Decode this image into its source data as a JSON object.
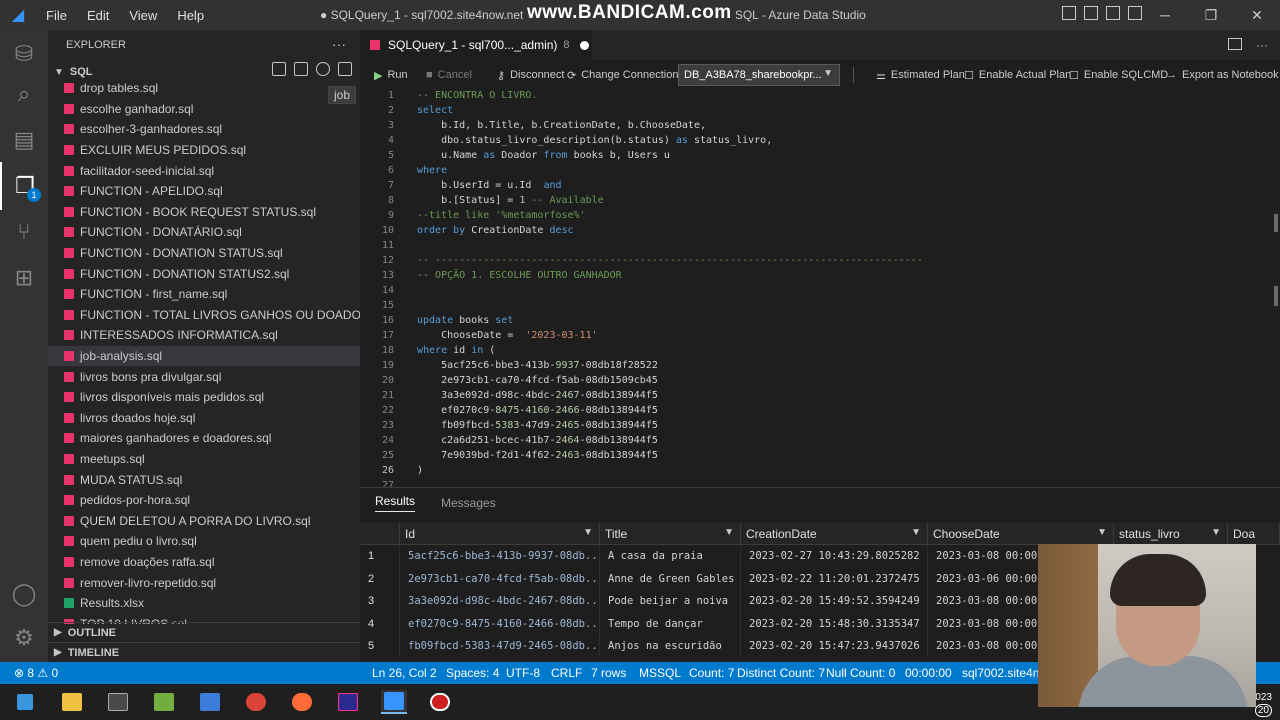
{
  "window": {
    "title": "● SQLQuery_1 - sql7002.site4now.net.DB_A3BA78_sharebookprod_admin) - SQL - Azure Data Studio",
    "watermark": "www.BANDICAM.com",
    "menu": [
      "File",
      "Edit",
      "View",
      "Help"
    ]
  },
  "sidebar": {
    "header": "EXPLORER",
    "section": "SQL",
    "hover_tooltip": "job",
    "files": [
      "drop tables.sql",
      "escolhe ganhador.sql",
      "escolher-3-ganhadores.sql",
      "EXCLUIR MEUS PEDIDOS.sql",
      "facilitador-seed-inicial.sql",
      "FUNCTION - APELIDO.sql",
      "FUNCTION - BOOK REQUEST STATUS.sql",
      "FUNCTION - DONATÁRIO.sql",
      "FUNCTION - DONATION STATUS.sql",
      "FUNCTION - DONATION STATUS2.sql",
      "FUNCTION - first_name.sql",
      "FUNCTION - TOTAL LIVROS GANHOS OU DOADOS.sql",
      "INTERESSADOS INFORMATICA.sql",
      "job-analysis.sql",
      "livros bons pra divulgar.sql",
      "livros disponíveis mais pedidos.sql",
      "livros doados hoje.sql",
      "maiores ganhadores e doadores.sql",
      "meetups.sql",
      "MUDA STATUS.sql",
      "pedidos-por-hora.sql",
      "QUEM DELETOU A PORRA DO LIVRO.sql",
      "quem pediu o livro.sql",
      "remove doações raffa.sql",
      "remover-livro-repetido.sql",
      "Results.xlsx",
      "TOP 10 LIVROS.sql"
    ],
    "selected_file": "job-analysis.sql",
    "outline": "OUTLINE",
    "timeline": "TIMELINE"
  },
  "activity_badge": "1",
  "editor": {
    "tab_label": "SQLQuery_1 - sql700..._admin)",
    "tab_number": "8",
    "toolbar": {
      "run": "Run",
      "cancel": "Cancel",
      "disconnect": "Disconnect",
      "change_connection": "Change Connection",
      "database": "DB_A3BA78_sharebookpr...",
      "estimated_plan": "Estimated Plan",
      "enable_actual_plan": "Enable Actual Plan",
      "enable_sqlcmd": "Enable SQLCMD",
      "export_notebook": "Export as Notebook"
    },
    "code_lines": [
      {
        "n": "1",
        "t": [
          [
            "cm",
            "-- ENCONTRA O LIVRO."
          ]
        ]
      },
      {
        "n": "2",
        "t": [
          [
            "kw",
            "select"
          ]
        ]
      },
      {
        "n": "3",
        "t": [
          [
            "pl",
            "    b.Id, b.Title, b.CreationDate, b.ChooseDate,"
          ]
        ]
      },
      {
        "n": "4",
        "t": [
          [
            "pl",
            "    dbo.status_livro_description(b.status) "
          ],
          [
            "kw",
            "as"
          ],
          [
            "pl",
            " status_livro,"
          ]
        ]
      },
      {
        "n": "5",
        "t": [
          [
            "pl",
            "    u.Name "
          ],
          [
            "kw",
            "as"
          ],
          [
            "pl",
            " Doador "
          ],
          [
            "kw",
            "from"
          ],
          [
            "pl",
            " books b, Users u"
          ]
        ]
      },
      {
        "n": "6",
        "t": [
          [
            "kw",
            "where"
          ]
        ]
      },
      {
        "n": "7",
        "t": [
          [
            "pl",
            "    b.UserId = u.Id  "
          ],
          [
            "kw",
            "and"
          ]
        ]
      },
      {
        "n": "8",
        "t": [
          [
            "pl",
            "    b.[Status] = "
          ],
          [
            "nm",
            "1"
          ],
          [
            "cm",
            " -- Available"
          ]
        ]
      },
      {
        "n": "9",
        "t": [
          [
            "cm",
            "--title like '%metamorfose%'"
          ]
        ]
      },
      {
        "n": "10",
        "t": [
          [
            "kw",
            "order by"
          ],
          [
            "pl",
            " CreationDate "
          ],
          [
            "kw",
            "desc"
          ]
        ]
      },
      {
        "n": "11",
        "t": []
      },
      {
        "n": "12",
        "t": [
          [
            "cm",
            "-- ---------------------------------------------------------------------------------"
          ]
        ]
      },
      {
        "n": "13",
        "t": [
          [
            "cm",
            "-- OPÇÃO 1. ESCOLHE OUTRO GANHADOR"
          ]
        ]
      },
      {
        "n": "14",
        "t": []
      },
      {
        "n": "15",
        "t": []
      },
      {
        "n": "16",
        "t": [
          [
            "kw",
            "update"
          ],
          [
            "pl",
            " books "
          ],
          [
            "kw",
            "set"
          ]
        ]
      },
      {
        "n": "17",
        "t": [
          [
            "pl",
            "    ChooseDate =  "
          ],
          [
            "st",
            "'2023-03-11'"
          ]
        ]
      },
      {
        "n": "18",
        "t": [
          [
            "kw",
            "where"
          ],
          [
            "pl",
            " id "
          ],
          [
            "kw",
            "in"
          ],
          [
            "pl",
            " ("
          ]
        ]
      },
      {
        "n": "19",
        "t": [
          [
            "pl",
            "    5acf25c6-bbe3-413b-"
          ],
          [
            "nm",
            "9937"
          ],
          [
            "pl",
            "-08db18f28522"
          ]
        ]
      },
      {
        "n": "20",
        "t": [
          [
            "pl",
            "    2e973cb1-ca70-4fcd-f5ab-08db1509cb45"
          ]
        ]
      },
      {
        "n": "21",
        "t": [
          [
            "pl",
            "    3a3e092d-d98c-4bdc-"
          ],
          [
            "nm",
            "2467"
          ],
          [
            "pl",
            "-08db138944f5"
          ]
        ]
      },
      {
        "n": "22",
        "t": [
          [
            "pl",
            "    ef0270c9-"
          ],
          [
            "nm",
            "8475"
          ],
          [
            "pl",
            "-"
          ],
          [
            "nm",
            "4160"
          ],
          [
            "pl",
            "-"
          ],
          [
            "nm",
            "2466"
          ],
          [
            "pl",
            "-08db138944f5"
          ]
        ]
      },
      {
        "n": "23",
        "t": [
          [
            "pl",
            "    fb09fbcd-"
          ],
          [
            "nm",
            "5383"
          ],
          [
            "pl",
            "-47d9-"
          ],
          [
            "nm",
            "2465"
          ],
          [
            "pl",
            "-08db138944f5"
          ]
        ]
      },
      {
        "n": "24",
        "t": [
          [
            "pl",
            "    c2a6d251-bcec-41b7-"
          ],
          [
            "nm",
            "2464"
          ],
          [
            "pl",
            "-08db138944f5"
          ]
        ]
      },
      {
        "n": "25",
        "t": [
          [
            "pl",
            "    7e9039bd-f2d1-4f62-"
          ],
          [
            "nm",
            "2463"
          ],
          [
            "pl",
            "-08db138944f5"
          ]
        ]
      },
      {
        "n": "26",
        "t": [
          [
            "pl",
            ")"
          ]
        ]
      },
      {
        "n": "27",
        "t": []
      }
    ],
    "current_line": "26"
  },
  "results": {
    "tabs": [
      "Results",
      "Messages"
    ],
    "columns": [
      "Id",
      "Title",
      "CreationDate",
      "ChooseDate",
      "status_livro",
      "Doa"
    ],
    "rows": [
      [
        "1",
        "5acf25c6-bbe3-413b-9937-08db...",
        "A casa da praia",
        "2023-02-27 10:43:29.8025282",
        "2023-03-08 00:00"
      ],
      [
        "2",
        "2e973cb1-ca70-4fcd-f5ab-08db...",
        "Anne de Green Gables",
        "2023-02-22 11:20:01.2372475",
        "2023-03-06 00:00"
      ],
      [
        "3",
        "3a3e092d-d98c-4bdc-2467-08db...",
        "Pode beijar a noiva",
        "2023-02-20 15:49:52.3594249",
        "2023-03-08 00:00"
      ],
      [
        "4",
        "ef0270c9-8475-4160-2466-08db...",
        "Tempo de dançar",
        "2023-02-20 15:48:30.3135347",
        "2023-03-08 00:00"
      ],
      [
        "5",
        "fb09fbcd-5383-47d9-2465-08db...",
        "Anjos na escuridão",
        "2023-02-20 15:47:23.9437026",
        "2023-03-08 00:00"
      ]
    ]
  },
  "statusbar": {
    "problems": "⊗ 8 ⚠ 0",
    "position": "Ln 26, Col 2",
    "spaces": "Spaces: 4",
    "encoding": "UTF-8",
    "eol": "CRLF",
    "rows": "7 rows",
    "lang": "MSSQL",
    "count": "Count: 7",
    "distinct": "Distinct Count: 7",
    "nulls": "Null Count: 0",
    "time": "00:00:00",
    "server": "sql7002.site4n"
  },
  "taskbar": {
    "clock_date": "03/03/2023",
    "notification_count": "20"
  },
  "colors": {
    "accent": "#007acc",
    "file_icon": "#e8336b",
    "xlsx_icon": "#21a366"
  }
}
